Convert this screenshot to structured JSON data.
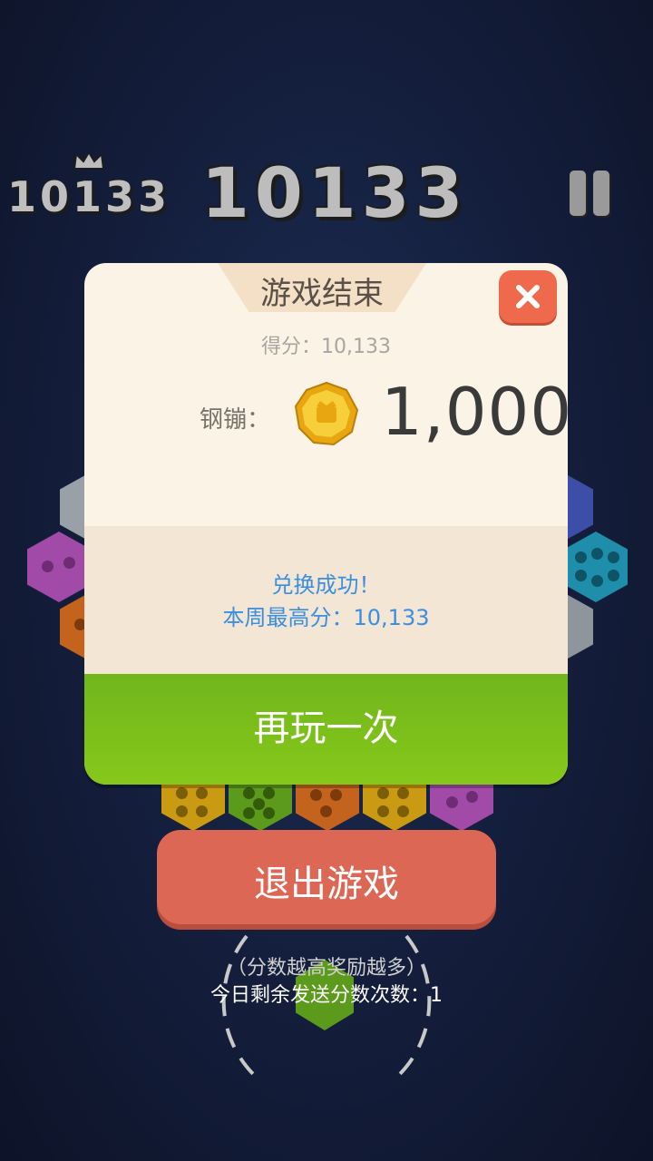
{
  "hud": {
    "best_score": "10133",
    "current_score": "10133"
  },
  "dialog": {
    "title": "游戏结束",
    "score_label": "得分：",
    "score_value": "10,133",
    "coin_label": "钢镚：",
    "coin_value": "1,000",
    "message": "兑换成功！",
    "weekly_best_label": "本周最高分：",
    "weekly_best_value": "10,133",
    "replay_label": "再玩一次"
  },
  "footer": {
    "exit_label": "退出游戏",
    "hint": "（分数越高奖励越多）",
    "remaining_label": "今日剩余发送分数次数：",
    "remaining_count": "1"
  },
  "colors": {
    "background": "#15203f",
    "close_button": "#ef6a4c",
    "replay_button": "#7fbf1a",
    "exit_button": "#dc6754",
    "info_text": "#3b8ee0"
  },
  "icons": [
    "crown-icon",
    "pause-icon",
    "close-icon",
    "coin-icon"
  ]
}
